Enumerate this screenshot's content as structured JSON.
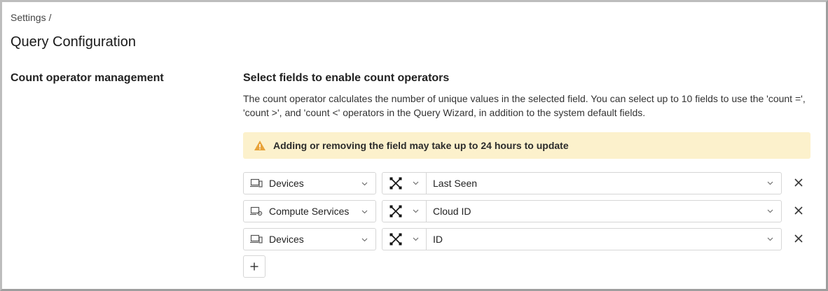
{
  "breadcrumb": "Settings /",
  "page_title": "Query Configuration",
  "section_label": "Count operator management",
  "subsection_title": "Select fields to enable count operators",
  "description": "The count operator calculates the number of unique values in the selected field. You can select up to 10 fields to use the 'count =', 'count >', and 'count <' operators in the Query Wizard, in addition to the system default fields.",
  "warning": {
    "text": "Adding or removing the field may take up to 24 hours to update",
    "color": "#e8a33a"
  },
  "rows": [
    {
      "entity": "Devices",
      "entity_icon": "device-icon",
      "adapter_icon": "aggregated-adapter-icon",
      "field": "Last Seen"
    },
    {
      "entity": "Compute Services",
      "entity_icon": "compute-services-icon",
      "adapter_icon": "aggregated-adapter-icon",
      "field": "Cloud ID"
    },
    {
      "entity": "Devices",
      "entity_icon": "device-icon",
      "adapter_icon": "aggregated-adapter-icon",
      "field": "ID"
    }
  ],
  "add_button_icon": "plus-icon",
  "remove_icon": "close-icon"
}
